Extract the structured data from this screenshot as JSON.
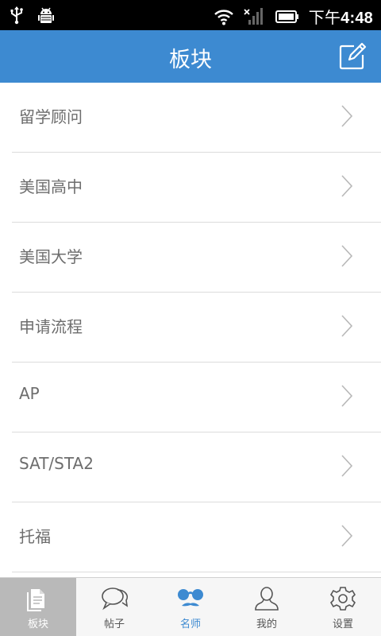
{
  "statusbar": {
    "time_prefix": "下午",
    "time": "4:48"
  },
  "header": {
    "title": "板块"
  },
  "list": {
    "items": [
      {
        "label": "留学顾问"
      },
      {
        "label": "美国高中"
      },
      {
        "label": "美国大学"
      },
      {
        "label": "申请流程"
      },
      {
        "label": "AP"
      },
      {
        "label": "SAT/STA2"
      },
      {
        "label": "托福"
      }
    ]
  },
  "tabs": [
    {
      "label": "板块",
      "icon": "document-icon",
      "state": "selected"
    },
    {
      "label": "帖子",
      "icon": "chat-bubbles-icon",
      "state": "normal"
    },
    {
      "label": "名师",
      "icon": "glasses-mustache-icon",
      "state": "highlighted"
    },
    {
      "label": "我的",
      "icon": "person-icon",
      "state": "normal"
    },
    {
      "label": "设置",
      "icon": "gear-icon",
      "state": "normal"
    }
  ],
  "colors": {
    "accent": "#3d8ad1",
    "tab_selected_bg": "#b9b9b9"
  }
}
